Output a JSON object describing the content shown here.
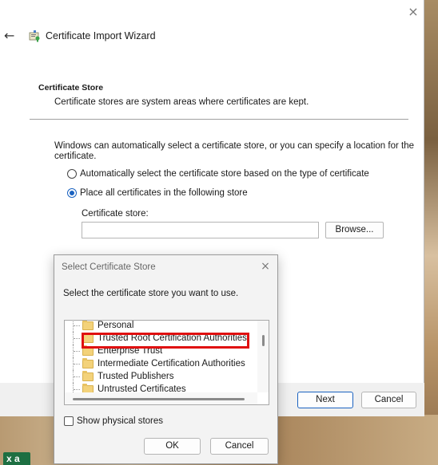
{
  "wizard": {
    "title": "Certificate Import Wizard",
    "close_icon": "×",
    "back_icon": "←",
    "section_title": "Certificate Store",
    "section_desc": "Certificate stores are system areas where certificates are kept.",
    "intro": "Windows can automatically select a certificate store, or you can specify a location for the certificate.",
    "radio_auto": "Automatically select the certificate store based on the type of certificate",
    "radio_manual": "Place all certificates in the following store",
    "radio_selected": "manual",
    "store_label": "Certificate store:",
    "store_value": "",
    "browse": "Browse...",
    "next": "Next",
    "cancel": "Cancel"
  },
  "dialog": {
    "title": "Select Certificate Store",
    "close_icon": "×",
    "prompt": "Select the certificate store you want to use.",
    "stores": [
      "Personal",
      "Trusted Root Certification Authorities",
      "Enterprise Trust",
      "Intermediate Certification Authorities",
      "Trusted Publishers",
      "Untrusted Certificates"
    ],
    "highlighted_store": "Trusted Root Certification Authorities",
    "show_physical": "Show physical stores",
    "show_physical_checked": false,
    "ok": "OK",
    "cancel": "Cancel"
  },
  "taskbar": {
    "excel_icon_letters": "x a"
  },
  "colors": {
    "accent": "#1a62c0",
    "highlight": "#e01010",
    "folder": "#f3d27a"
  }
}
